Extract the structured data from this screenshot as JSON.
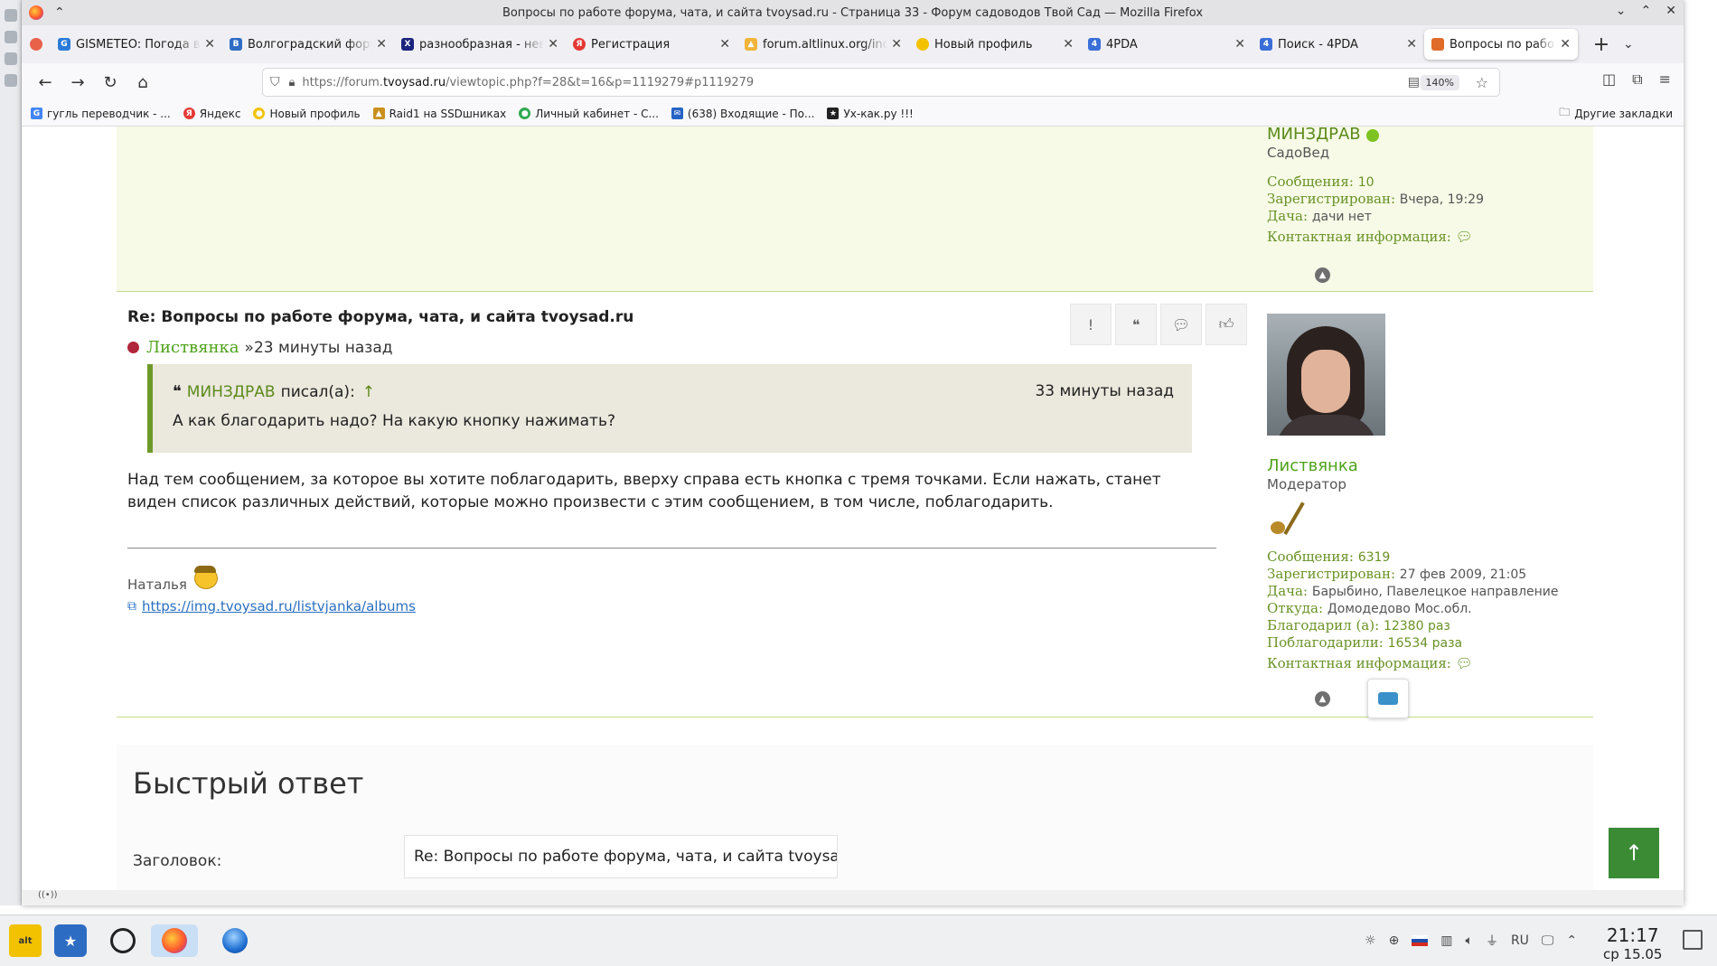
{
  "window": {
    "title": "Вопросы по работе форума, чата, и сайта tvoysad.ru - Страница 33 - Форум садоводов Твой Сад — Mozilla Firefox"
  },
  "tabs": [
    {
      "label": "GISMETEO: Погода в Волгограде",
      "icon": "gismeteo-icon",
      "color": "#2b7bd8"
    },
    {
      "label": "Волгоградский форум",
      "icon": "vk-icon",
      "color": "#2d6cc3"
    },
    {
      "label": "разнообразная - неверная",
      "icon": "x-icon",
      "color": "#1a237e"
    },
    {
      "label": "Регистрация",
      "icon": "yandex-icon",
      "color": "#e53935"
    },
    {
      "label": "forum.altlinux.org/index",
      "icon": "altlinux-icon",
      "color": "#f0b43a"
    },
    {
      "label": "Новый профиль",
      "icon": "beeline-icon",
      "color": "#f2c200"
    },
    {
      "label": "4PDA",
      "icon": "4pda-icon",
      "color": "#3a6fd8"
    },
    {
      "label": "Поиск - 4PDA",
      "icon": "4pda-icon",
      "color": "#3a6fd8"
    },
    {
      "label": "Вопросы по работе форума",
      "icon": "tvoysad-icon",
      "color": "#e06b2b"
    }
  ],
  "address": {
    "prefix": "https://forum.",
    "domain": "tvoysad.ru",
    "path": "/viewtopic.php?f=28&t=16&p=1119279#p1119279",
    "zoom": "140%"
  },
  "bookmarks": [
    {
      "label": "гугль переводчик - ...",
      "color": "#4285f4",
      "glyph": "G"
    },
    {
      "label": "Яндекс",
      "color": "#e53935",
      "glyph": "Я"
    },
    {
      "label": "Новый профиль",
      "color": "#f2c200",
      "glyph": "●"
    },
    {
      "label": "Raid1 на SSDшниках",
      "color": "#c9901e",
      "glyph": "▲"
    },
    {
      "label": "Личный кабинет - С...",
      "color": "#2fa84f",
      "glyph": "●"
    },
    {
      "label": "(638) Входящие - По...",
      "color": "#2563c4",
      "glyph": "✉"
    },
    {
      "label": "Ух-как.ру !!!",
      "color": "#222222",
      "glyph": "★"
    }
  ],
  "bookmarks_other": "Другие закладки",
  "prev_post": {
    "author": "МИНЗДРАВ",
    "rank": "СадоВед",
    "messages_label": "Сообщения:",
    "messages": "10",
    "registered_label": "Зарегистрирован:",
    "registered": "Вчера, 19:29",
    "dacha_label": "Дача:",
    "dacha": "дачи нет",
    "contact_label": "Контактная информация:"
  },
  "post": {
    "title": "Re: Вопросы по работе форума, чата, и сайта tvoysad.ru",
    "author": "Листвянка",
    "separator": "»",
    "time": "23 минуты назад",
    "quote": {
      "author": "МИНЗДРАВ",
      "wrote": "писал(а):",
      "arrow": "↑",
      "time": "33 минуты назад",
      "text": "А как благодарить надо? На какую кнопку нажимать?"
    },
    "text": "Над тем сообщением, за которое вы хотите поблагодарить, вверху справа есть кнопка с тремя точками. Если нажать, станет виден список различных действий, которые можно произвести с этим сообщением, в том числе, поблагодарить.",
    "signature_name": "Наталья",
    "signature_link": "https://img.tvoysad.ru/listvjanka/albums"
  },
  "profile": {
    "name": "Листвянка",
    "rank": "Модератор",
    "messages_label": "Сообщения:",
    "messages": "6319",
    "registered_label": "Зарегистрирован:",
    "registered": "27 фев 2009, 21:05",
    "dacha_label": "Дача:",
    "dacha": "Барыбино, Павелецкое направление",
    "from_label": "Откуда:",
    "from": "Домодедово Мос.обл.",
    "thanked_label": "Благодарил (а):",
    "thanked": "12380 раз",
    "been_thanked_label": "Поблагодарили:",
    "been_thanked": "16534 раза",
    "contact_label": "Контактная информация:"
  },
  "quick_reply": {
    "title": "Быстрый ответ",
    "subject_label": "Заголовок:",
    "subject_value": "Re: Вопросы по работе форума, чата, и сайта tvoysa"
  },
  "taskbar": {
    "lang": "RU",
    "time": "21:17",
    "date": "ср 15.05"
  },
  "colors": {
    "forum_green": "#5b8a19",
    "author_green": "#4ea21a",
    "online": "#7cc322",
    "scroll_button": "#3b8b35"
  }
}
